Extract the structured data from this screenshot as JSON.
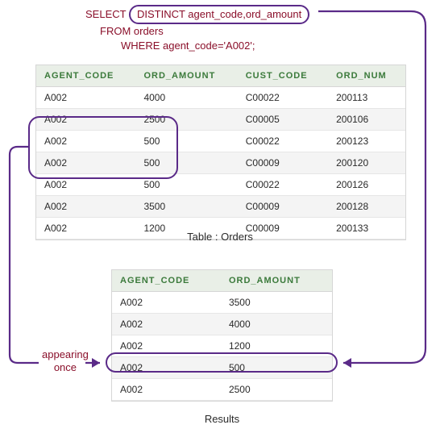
{
  "sql": {
    "keyword_select": "SELECT",
    "distinct_clause": "DISTINCT agent_code,ord_amount",
    "from_line": "FROM orders",
    "where_line": "WHERE agent_code='A002';"
  },
  "orders_table": {
    "caption": "Table : Orders",
    "headers": [
      "AGENT_CODE",
      "ORD_AMOUNT",
      "CUST_CODE",
      "ORD_NUM"
    ],
    "rows": [
      [
        "A002",
        "4000",
        "C00022",
        "200113"
      ],
      [
        "A002",
        "2500",
        "C00005",
        "200106"
      ],
      [
        "A002",
        "500",
        "C00022",
        "200123"
      ],
      [
        "A002",
        "500",
        "C00009",
        "200120"
      ],
      [
        "A002",
        "500",
        "C00022",
        "200126"
      ],
      [
        "A002",
        "3500",
        "C00009",
        "200128"
      ],
      [
        "A002",
        "1200",
        "C00009",
        "200133"
      ]
    ]
  },
  "results_table": {
    "caption": "Results",
    "headers": [
      "AGENT_CODE",
      "ORD_AMOUNT"
    ],
    "rows": [
      [
        "A002",
        "3500"
      ],
      [
        "A002",
        "4000"
      ],
      [
        "A002",
        "1200"
      ],
      [
        "A002",
        "500"
      ],
      [
        "A002",
        "2500"
      ]
    ]
  },
  "annotations": {
    "appearing_once": "appearing\nonce"
  },
  "colors": {
    "accent_purple": "#5a2a88",
    "text_maroon": "#8a0f2a",
    "header_green": "#3b7a3b",
    "header_bg": "#e9efe7"
  },
  "chart_data": {
    "type": "table",
    "title": "SQL DISTINCT illustration",
    "sql": "SELECT DISTINCT agent_code,ord_amount FROM orders WHERE agent_code='A002';",
    "source_table": {
      "name": "orders",
      "columns": [
        "AGENT_CODE",
        "ORD_AMOUNT",
        "CUST_CODE",
        "ORD_NUM"
      ],
      "rows": [
        [
          "A002",
          4000,
          "C00022",
          200113
        ],
        [
          "A002",
          2500,
          "C00005",
          200106
        ],
        [
          "A002",
          500,
          "C00022",
          200123
        ],
        [
          "A002",
          500,
          "C00009",
          200120
        ],
        [
          "A002",
          500,
          "C00022",
          200126
        ],
        [
          "A002",
          3500,
          "C00009",
          200128
        ],
        [
          "A002",
          1200,
          "C00009",
          200133
        ]
      ]
    },
    "result_table": {
      "columns": [
        "AGENT_CODE",
        "ORD_AMOUNT"
      ],
      "rows": [
        [
          "A002",
          3500
        ],
        [
          "A002",
          4000
        ],
        [
          "A002",
          1200
        ],
        [
          "A002",
          500
        ],
        [
          "A002",
          2500
        ]
      ]
    },
    "highlight": {
      "duplicate_group": {
        "agent_code": "A002",
        "ord_amount": 500,
        "source_row_indices": [
          2,
          3,
          4
        ],
        "result_row_index": 3,
        "note": "appearing once"
      }
    }
  }
}
